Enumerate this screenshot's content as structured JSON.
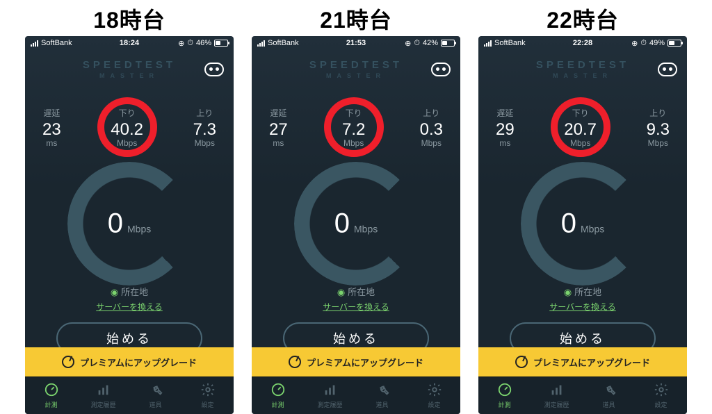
{
  "shots": [
    {
      "title": "18時台",
      "status": {
        "carrier": "SoftBank",
        "time": "18:24",
        "battery_pct": "46%",
        "battery_fill": 0.46
      },
      "logo": {
        "t1": "SPEEDTEST",
        "t2": "MASTER"
      },
      "metrics": {
        "delay": {
          "label": "遅延",
          "value": "23",
          "unit": "ms"
        },
        "down": {
          "label": "下り",
          "value": "40.2",
          "unit": "Mbps"
        },
        "up": {
          "label": "上り",
          "value": "7.3",
          "unit": "Mbps"
        }
      },
      "gauge": {
        "value": "0",
        "unit": "Mbps"
      },
      "location": {
        "label": "所在地"
      },
      "server_link": "サーバーを換える",
      "start": "始める",
      "premium": "プレミアムにアップグレード",
      "tabs": [
        {
          "label": "計測",
          "active": true
        },
        {
          "label": "測定履歴",
          "active": false
        },
        {
          "label": "道具",
          "active": false
        },
        {
          "label": "設定",
          "active": false
        }
      ]
    },
    {
      "title": "21時台",
      "status": {
        "carrier": "SoftBank",
        "time": "21:53",
        "battery_pct": "42%",
        "battery_fill": 0.42
      },
      "logo": {
        "t1": "SPEEDTEST",
        "t2": "MASTER"
      },
      "metrics": {
        "delay": {
          "label": "遅延",
          "value": "27",
          "unit": "ms"
        },
        "down": {
          "label": "下り",
          "value": "7.2",
          "unit": "Mbps"
        },
        "up": {
          "label": "上り",
          "value": "0.3",
          "unit": "Mbps"
        }
      },
      "gauge": {
        "value": "0",
        "unit": "Mbps"
      },
      "location": {
        "label": "所在地"
      },
      "server_link": "サーバーを換える",
      "start": "始める",
      "premium": "プレミアムにアップグレード",
      "tabs": [
        {
          "label": "計測",
          "active": true
        },
        {
          "label": "測定履歴",
          "active": false
        },
        {
          "label": "道具",
          "active": false
        },
        {
          "label": "設定",
          "active": false
        }
      ]
    },
    {
      "title": "22時台",
      "status": {
        "carrier": "SoftBank",
        "time": "22:28",
        "battery_pct": "49%",
        "battery_fill": 0.49
      },
      "logo": {
        "t1": "SPEEDTEST",
        "t2": "MASTER"
      },
      "metrics": {
        "delay": {
          "label": "遅延",
          "value": "29",
          "unit": "ms"
        },
        "down": {
          "label": "下り",
          "value": "20.7",
          "unit": "Mbps"
        },
        "up": {
          "label": "上り",
          "value": "9.3",
          "unit": "Mbps"
        }
      },
      "gauge": {
        "value": "0",
        "unit": "Mbps"
      },
      "location": {
        "label": "所在地"
      },
      "server_link": "サーバーを換える",
      "start": "始める",
      "premium": "プレミアムにアップグレード",
      "tabs": [
        {
          "label": "計測",
          "active": true
        },
        {
          "label": "測定履歴",
          "active": false
        },
        {
          "label": "道具",
          "active": false
        },
        {
          "label": "設定",
          "active": false
        }
      ]
    }
  ]
}
